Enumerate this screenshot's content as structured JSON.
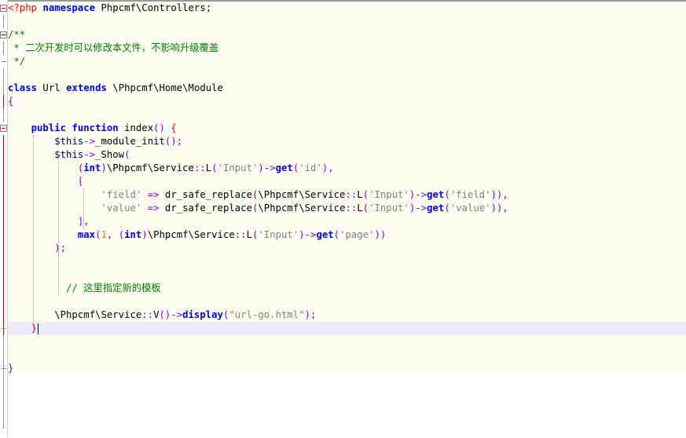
{
  "editor": {
    "lines": [
      {
        "n": 1,
        "tokens": [
          {
            "t": "php",
            "v": "<?php"
          },
          {
            "t": "txt",
            "v": " "
          },
          {
            "t": "kw",
            "v": "namespace"
          },
          {
            "t": "txt",
            "v": " Phpcmf\\Controllers;"
          }
        ]
      },
      {
        "n": 2,
        "tokens": []
      },
      {
        "n": 3,
        "tokens": [
          {
            "t": "cmt",
            "v": "/**"
          }
        ]
      },
      {
        "n": 4,
        "tokens": [
          {
            "t": "cmt",
            "v": " * 二次开发时可以修改本文件，不影响升级覆盖"
          }
        ]
      },
      {
        "n": 5,
        "tokens": [
          {
            "t": "cmt",
            "v": " */"
          }
        ]
      },
      {
        "n": 6,
        "tokens": []
      },
      {
        "n": 7,
        "tokens": [
          {
            "t": "kw",
            "v": "class"
          },
          {
            "t": "txt",
            "v": " Url "
          },
          {
            "t": "kw",
            "v": "extends"
          },
          {
            "t": "txt",
            "v": " \\Phpcmf\\Home\\Module"
          }
        ]
      },
      {
        "n": 8,
        "tokens": [
          {
            "t": "op",
            "v": "{"
          }
        ]
      },
      {
        "n": 9,
        "tokens": []
      },
      {
        "n": 10,
        "tokens": [
          {
            "t": "txt",
            "v": "    "
          },
          {
            "t": "kw",
            "v": "public"
          },
          {
            "t": "txt",
            "v": " "
          },
          {
            "t": "kw",
            "v": "function"
          },
          {
            "t": "txt",
            "v": " index"
          },
          {
            "t": "op",
            "v": "()"
          },
          {
            "t": "txt",
            "v": " "
          },
          {
            "t": "red",
            "v": "{"
          }
        ]
      },
      {
        "n": 11,
        "tokens": [
          {
            "t": "txt",
            "v": "        "
          },
          {
            "t": "var",
            "v": "$this"
          },
          {
            "t": "op",
            "v": "->"
          },
          {
            "t": "txt",
            "v": "_module_init"
          },
          {
            "t": "op",
            "v": "();"
          }
        ]
      },
      {
        "n": 12,
        "tokens": [
          {
            "t": "txt",
            "v": "        "
          },
          {
            "t": "var",
            "v": "$this"
          },
          {
            "t": "op",
            "v": "->"
          },
          {
            "t": "txt",
            "v": "_Show"
          },
          {
            "t": "op",
            "v": "("
          }
        ]
      },
      {
        "n": 13,
        "tokens": [
          {
            "t": "txt",
            "v": "            "
          },
          {
            "t": "op",
            "v": "("
          },
          {
            "t": "kw",
            "v": "int"
          },
          {
            "t": "op",
            "v": ")"
          },
          {
            "t": "txt",
            "v": "\\Phpcmf\\Service"
          },
          {
            "t": "op",
            "v": "::"
          },
          {
            "t": "txt",
            "v": "L"
          },
          {
            "t": "op",
            "v": "("
          },
          {
            "t": "str",
            "v": "'Input'"
          },
          {
            "t": "op",
            "v": ")->"
          },
          {
            "t": "kw",
            "v": "get"
          },
          {
            "t": "op",
            "v": "("
          },
          {
            "t": "str",
            "v": "'id'"
          },
          {
            "t": "op",
            "v": "),"
          }
        ]
      },
      {
        "n": 14,
        "tokens": [
          {
            "t": "txt",
            "v": "            "
          },
          {
            "t": "op",
            "v": "["
          }
        ]
      },
      {
        "n": 15,
        "tokens": [
          {
            "t": "txt",
            "v": "                "
          },
          {
            "t": "str",
            "v": "'field'"
          },
          {
            "t": "txt",
            "v": " "
          },
          {
            "t": "op",
            "v": "=>"
          },
          {
            "t": "txt",
            "v": " dr_safe_replace"
          },
          {
            "t": "op",
            "v": "("
          },
          {
            "t": "txt",
            "v": "\\Phpcmf\\Service"
          },
          {
            "t": "op",
            "v": "::"
          },
          {
            "t": "txt",
            "v": "L"
          },
          {
            "t": "op",
            "v": "("
          },
          {
            "t": "str",
            "v": "'Input'"
          },
          {
            "t": "op",
            "v": ")->"
          },
          {
            "t": "kw",
            "v": "get"
          },
          {
            "t": "op",
            "v": "("
          },
          {
            "t": "str",
            "v": "'field'"
          },
          {
            "t": "op",
            "v": ")),"
          }
        ]
      },
      {
        "n": 16,
        "tokens": [
          {
            "t": "txt",
            "v": "                "
          },
          {
            "t": "str",
            "v": "'value'"
          },
          {
            "t": "txt",
            "v": " "
          },
          {
            "t": "op",
            "v": "=>"
          },
          {
            "t": "txt",
            "v": " dr_safe_replace"
          },
          {
            "t": "op",
            "v": "("
          },
          {
            "t": "txt",
            "v": "\\Phpcmf\\Service"
          },
          {
            "t": "op",
            "v": "::"
          },
          {
            "t": "txt",
            "v": "L"
          },
          {
            "t": "op",
            "v": "("
          },
          {
            "t": "str",
            "v": "'Input'"
          },
          {
            "t": "op",
            "v": ")->"
          },
          {
            "t": "kw",
            "v": "get"
          },
          {
            "t": "op",
            "v": "("
          },
          {
            "t": "str",
            "v": "'value'"
          },
          {
            "t": "op",
            "v": ")),"
          }
        ]
      },
      {
        "n": 17,
        "tokens": [
          {
            "t": "txt",
            "v": "            "
          },
          {
            "t": "op",
            "v": "],"
          }
        ]
      },
      {
        "n": 18,
        "tokens": [
          {
            "t": "txt",
            "v": "            "
          },
          {
            "t": "kw",
            "v": "max"
          },
          {
            "t": "op",
            "v": "("
          },
          {
            "t": "num",
            "v": "1"
          },
          {
            "t": "op",
            "v": ","
          },
          {
            "t": "txt",
            "v": " "
          },
          {
            "t": "op",
            "v": "("
          },
          {
            "t": "kw",
            "v": "int"
          },
          {
            "t": "op",
            "v": ")"
          },
          {
            "t": "txt",
            "v": "\\Phpcmf\\Service"
          },
          {
            "t": "op",
            "v": "::"
          },
          {
            "t": "txt",
            "v": "L"
          },
          {
            "t": "op",
            "v": "("
          },
          {
            "t": "str",
            "v": "'Input'"
          },
          {
            "t": "op",
            "v": ")->"
          },
          {
            "t": "kw",
            "v": "get"
          },
          {
            "t": "op",
            "v": "("
          },
          {
            "t": "str",
            "v": "'page'"
          },
          {
            "t": "op",
            "v": "))"
          }
        ]
      },
      {
        "n": 19,
        "tokens": [
          {
            "t": "txt",
            "v": "        "
          },
          {
            "t": "op",
            "v": ");"
          }
        ]
      },
      {
        "n": 20,
        "tokens": []
      },
      {
        "n": 21,
        "tokens": []
      },
      {
        "n": 22,
        "tokens": [
          {
            "t": "txt",
            "v": "          "
          },
          {
            "t": "cmt",
            "v": "// 这里指定新的模板"
          }
        ]
      },
      {
        "n": 23,
        "tokens": []
      },
      {
        "n": 24,
        "tokens": [
          {
            "t": "txt",
            "v": "        \\Phpcmf\\Service"
          },
          {
            "t": "op",
            "v": "::"
          },
          {
            "t": "txt",
            "v": "V"
          },
          {
            "t": "op",
            "v": "()->"
          },
          {
            "t": "kw",
            "v": "display"
          },
          {
            "t": "op",
            "v": "("
          },
          {
            "t": "str",
            "v": "\"url-go.html\""
          },
          {
            "t": "op",
            "v": ");"
          }
        ]
      },
      {
        "n": 25,
        "tokens": [
          {
            "t": "txt",
            "v": "    "
          },
          {
            "t": "red",
            "v": "}"
          }
        ],
        "current": true
      },
      {
        "n": 26,
        "tokens": []
      },
      {
        "n": 27,
        "tokens": []
      },
      {
        "n": 28,
        "tokens": [
          {
            "t": "op",
            "v": "}"
          }
        ]
      }
    ]
  }
}
